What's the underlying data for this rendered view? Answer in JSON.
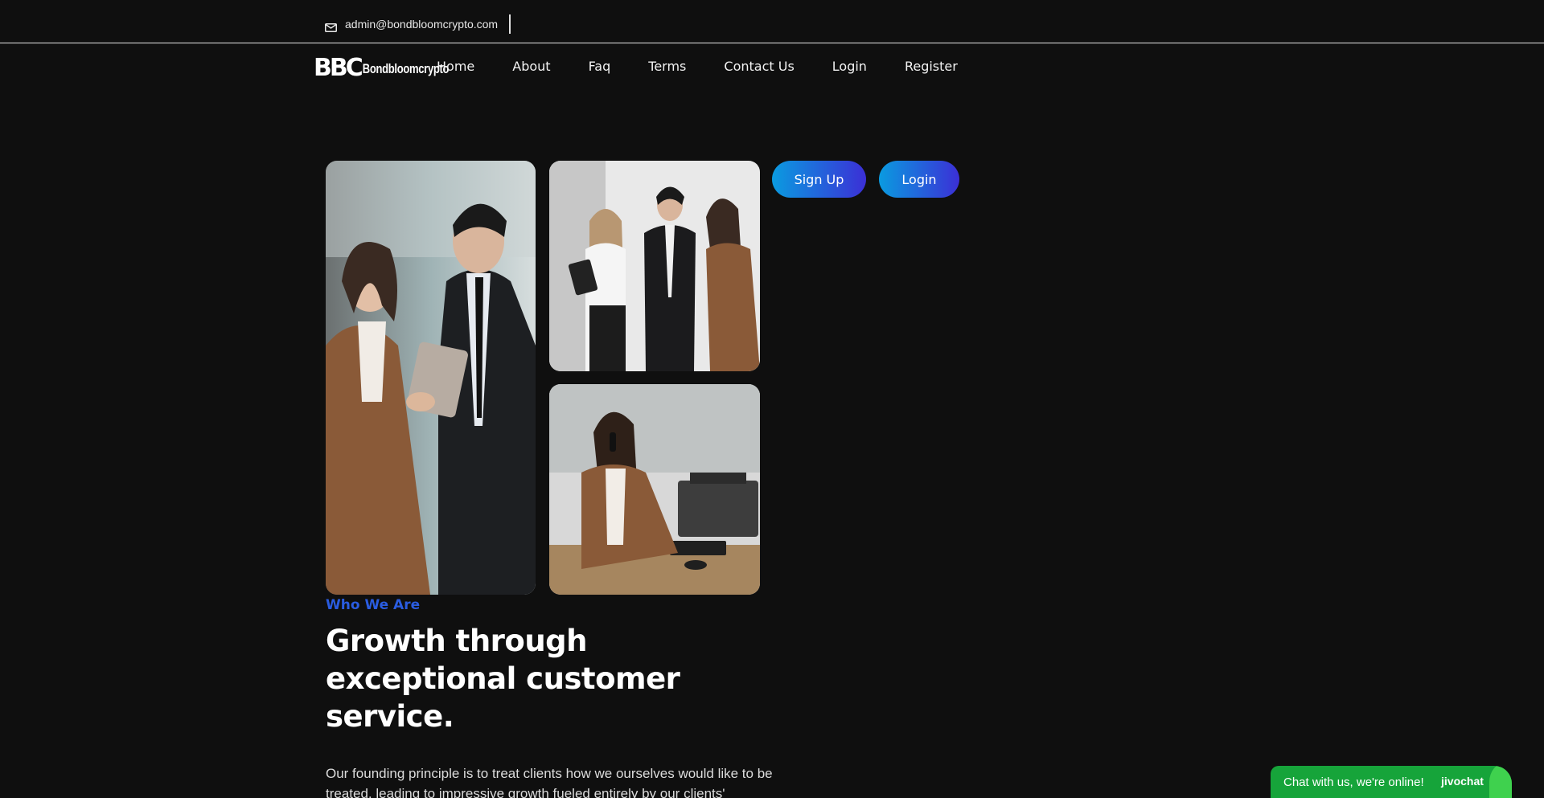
{
  "topbar": {
    "email": "admin@bondbloomcrypto.com",
    "icon": "mail-icon"
  },
  "logo": {
    "mark": "BBC",
    "wordmark": "Bondbloomcrypto"
  },
  "nav": {
    "items": [
      "Home",
      "About",
      "Faq",
      "Terms",
      "Contact Us",
      "Login",
      "Register"
    ]
  },
  "auth_buttons": {
    "signup": "Sign Up",
    "login": "Login"
  },
  "about": {
    "eyebrow": "Who We Are",
    "headline": "Growth through exceptional customer service.",
    "body": "Our founding principle is to treat clients how we ourselves would like to be treated, leading to impressive growth fueled entirely by our clients'"
  },
  "chat": {
    "text": "Chat with us, we're online!",
    "brand": "jivochat"
  },
  "colors": {
    "background": "#0f0f0f",
    "accent_blue": "#2a5ce0",
    "button_gradient_start": "#0a9be0",
    "button_gradient_end": "#3b2fd6",
    "chat_green": "#16a43a"
  }
}
